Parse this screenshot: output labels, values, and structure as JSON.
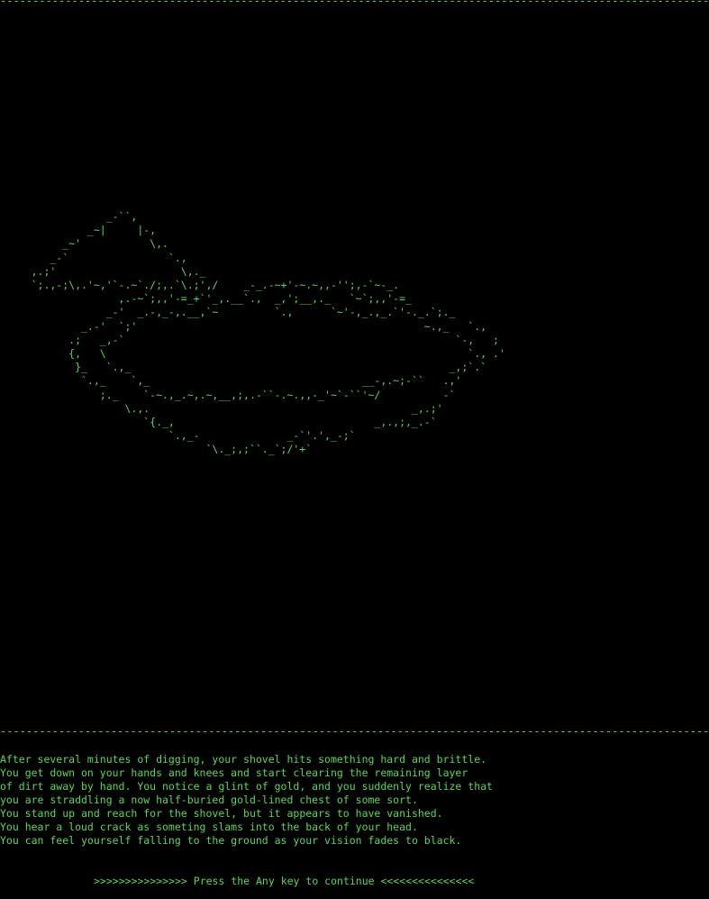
{
  "colors": {
    "background": "#000000",
    "text": "#5dd55d"
  },
  "top_rule": "----------------------------------------------------------------------------------------------------------------------------------",
  "middle_rule": "----------------------------------------------------------------------------------------------------------------------------------",
  "ascii_art": "                 _-``,\n              _~|     |-,\n          _~'           \\,.\n        _-`                `.,\n     ,.;'                    \\,._\n     `;.,-;\\,.'~,'`-.~`./;,.`\\.;',/    _-_.-~+'-~.~,,-'';,-`~-_.\n                   ,.-~`;,,'-=_+`'_,.__`.,  _,';__,._   `~`;,,'-=_\n                 _-'  _.-,_-,.__,`~         `.,      `~'-,_.,_.`'-._.`;._\n             _.-'  `;'                                              ~.,_   `.,\n           .;   _,-`                                                     `-,   ;\n           {,   \\                                                          `., .'\n            }_   `.,_                                                   _,;`.`\n             `.,_    `,_                                  __-,.~;-``   .,'\n                ;._    `-~.,_.~,.~,__,;,.-``-.~.,,-_'~`-``'~/          -`\n                    \\.,.                                          _,.;'\n                       `{._,                                _,.,;,_.-`\n                           `.,_-              _-`'.',_-;`\n                                 `\\._;,;``._`;/'+`",
  "narrative": [
    "After several minutes of digging, your shovel hits something hard and brittle.",
    "You get down on your hands and knees and start clearing the remaining layer",
    "of dirt away by hand. You notice a glint of gold, and you suddenly realize that",
    "you are straddling a now half-buried gold-lined chest of some sort.",
    "You stand up and reach for the shovel, but it appears to have vanished.",
    "You hear a loud crack as someting slams into the back of your head.",
    "You can feel yourself falling to the ground as your vision fades to black."
  ],
  "prompt": ">>>>>>>>>>>>>>> Press the Any key to continue <<<<<<<<<<<<<<<"
}
